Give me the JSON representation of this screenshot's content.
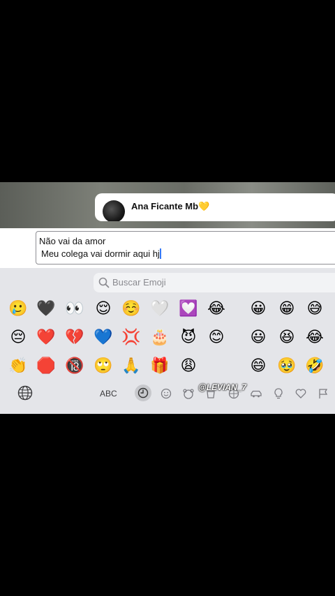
{
  "notification": {
    "sender": "Ana Ficante Mb💛"
  },
  "message_input": {
    "line1": "Não vai da amor",
    "line2": "Meu colega vai dormir aqui hj"
  },
  "emoji_search": {
    "placeholder": "Buscar Emoji"
  },
  "emoji_grid": {
    "row1": [
      "🥲",
      "🖤",
      "👀",
      "😌",
      "☺️",
      "🤍",
      "💟",
      "😂",
      "😀",
      "😁",
      "😅"
    ],
    "row2": [
      "😔",
      "❤️",
      "💔",
      "💙",
      "💢",
      "🎂",
      "😈",
      "😊",
      "😃",
      "😆",
      "😂"
    ],
    "row3": [
      "👏",
      "🛑",
      "🔞",
      "🙄",
      "🙏",
      "🎁",
      "😩",
      "",
      "😄",
      "🥹",
      "🤣"
    ]
  },
  "toolbar": {
    "abc_label": "ABC",
    "categories": [
      "recent",
      "smileys",
      "animals",
      "food",
      "activity",
      "travel",
      "objects",
      "symbols",
      "flags"
    ]
  },
  "watermark": "@LEVIAN_7"
}
